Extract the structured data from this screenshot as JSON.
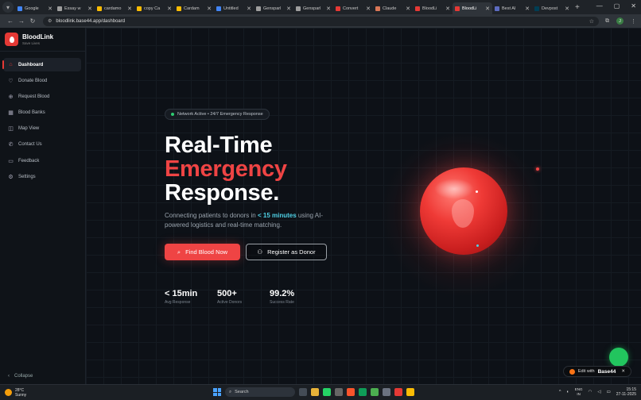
{
  "browser": {
    "tabs": [
      {
        "label": "Google",
        "color": "#4285f4",
        "active": false
      },
      {
        "label": "Essay w",
        "color": "#9e9e9e",
        "active": false
      },
      {
        "label": "cardamo",
        "color": "#fbbc05",
        "active": false
      },
      {
        "label": "copy Ca",
        "color": "#fbbc05",
        "active": false
      },
      {
        "label": "Cardam",
        "color": "#fbbc05",
        "active": false
      },
      {
        "label": "Untitled",
        "color": "#4285f4",
        "active": false
      },
      {
        "label": "Gensparl",
        "color": "#9e9e9e",
        "active": false
      },
      {
        "label": "Gensparl",
        "color": "#9e9e9e",
        "active": false
      },
      {
        "label": "Convert",
        "color": "#e53935",
        "active": false
      },
      {
        "label": "Claude",
        "color": "#d97757",
        "active": false
      },
      {
        "label": "BloodLi",
        "color": "#e53935",
        "active": false
      },
      {
        "label": "BloodLi",
        "color": "#e53935",
        "active": true
      },
      {
        "label": "Best AI",
        "color": "#5c6bc0",
        "active": false
      },
      {
        "label": "Devpost",
        "color": "#003e54",
        "active": false
      }
    ],
    "url": "bloodlink.base44.app/dashboard",
    "profile_initial": "J"
  },
  "sidebar": {
    "brand_name": "BloodLink",
    "brand_sub": "Save Lives",
    "items": [
      {
        "label": "Dashboard",
        "icon": "home-icon",
        "active": true
      },
      {
        "label": "Donate Blood",
        "icon": "heart-icon",
        "active": false
      },
      {
        "label": "Request Blood",
        "icon": "plus-circle-icon",
        "active": false
      },
      {
        "label": "Blood Banks",
        "icon": "building-icon",
        "active": false
      },
      {
        "label": "Map View",
        "icon": "map-icon",
        "active": false
      },
      {
        "label": "Contact Us",
        "icon": "phone-icon",
        "active": false
      },
      {
        "label": "Feedback",
        "icon": "message-icon",
        "active": false
      },
      {
        "label": "Settings",
        "icon": "gear-icon",
        "active": false
      }
    ],
    "collapse_label": "Collapse"
  },
  "hero": {
    "badge": "Network Active • 24/7 Emergency Response",
    "title_line1": "Real-Time",
    "title_line2": "Emergency",
    "title_line3": "Response.",
    "lead_before": "Connecting patients to donors in ",
    "lead_highlight": "< 15 minutes",
    "lead_after": " using AI-powered logistics and real-time matching.",
    "primary_button": "Find Blood Now",
    "secondary_button": "Register as Donor",
    "stats": [
      {
        "value": "< 15min",
        "label": "Avg Response"
      },
      {
        "value": "500+",
        "label": "Active Donors"
      },
      {
        "value": "99.2%",
        "label": "Success Rate"
      }
    ]
  },
  "edit_pill": {
    "prefix": "Edit with",
    "brand": "Base44"
  },
  "taskbar": {
    "weather_temp": "28°C",
    "weather_desc": "Sunny",
    "search_placeholder": "Search",
    "lang_line1": "ENG",
    "lang_line2": "IN",
    "time": "15:15",
    "date": "27-11-2025"
  },
  "colors": {
    "accent": "#ef4444",
    "highlight": "#4fd1e6",
    "success": "#22c55e"
  }
}
